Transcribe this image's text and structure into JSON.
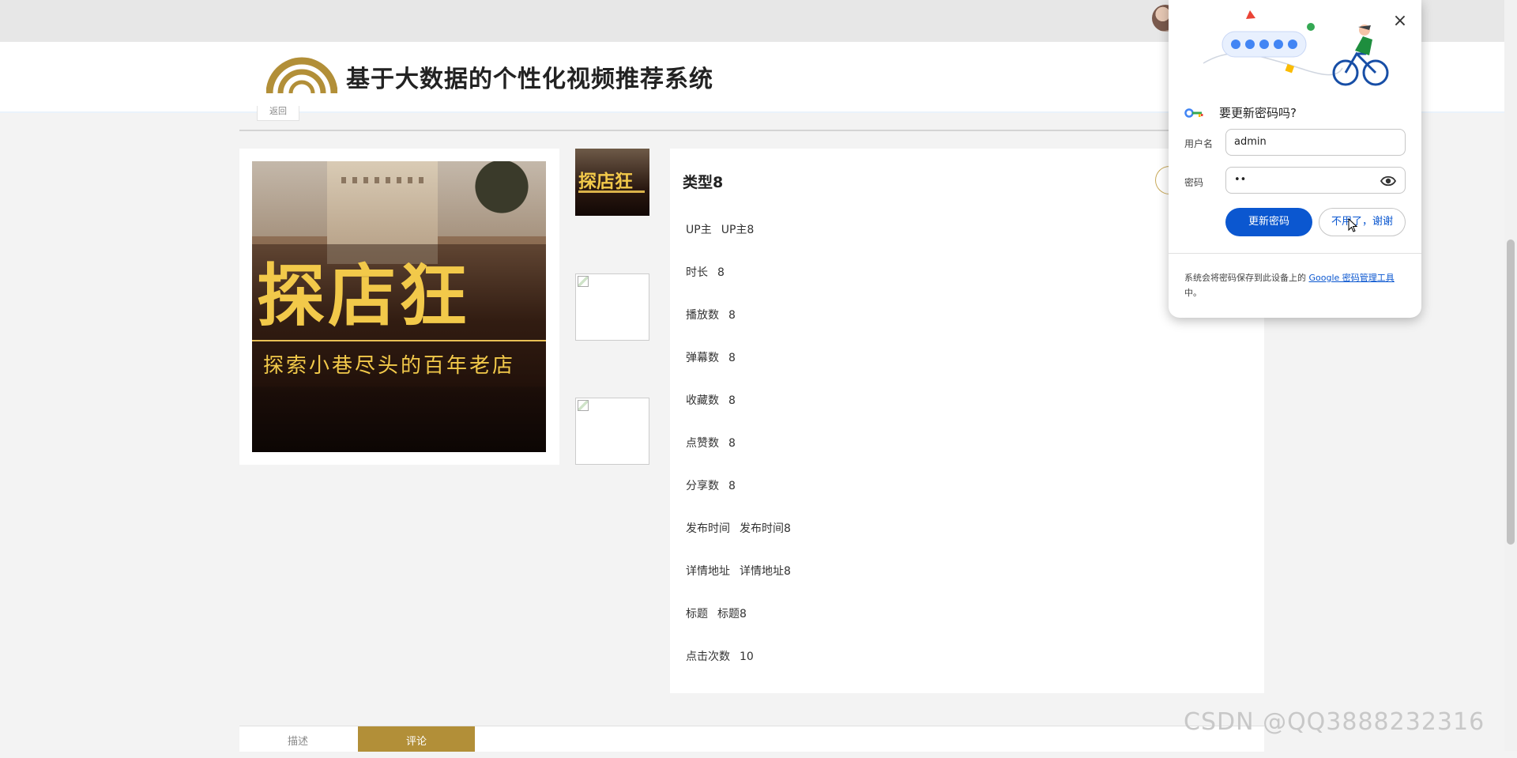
{
  "site": {
    "title": "基于大数据的个性化视频推荐系统",
    "back_label": "返回"
  },
  "poster": {
    "title": "探店狂",
    "subtitle": "探索小巷尽头的百年老店"
  },
  "thumbnails": [
    {
      "title": "探店狂"
    },
    {
      "title": ""
    },
    {
      "title": ""
    }
  ],
  "detail": {
    "title": "类型8",
    "rows": [
      {
        "key": "UP主",
        "value": "UP主8"
      },
      {
        "key": "时长",
        "value": "8"
      },
      {
        "key": "播放数",
        "value": "8"
      },
      {
        "key": "弹幕数",
        "value": "8"
      },
      {
        "key": "收藏数",
        "value": "8"
      },
      {
        "key": "点赞数",
        "value": "8"
      },
      {
        "key": "分享数",
        "value": "8"
      },
      {
        "key": "发布时间",
        "value": "发布时间8"
      },
      {
        "key": "详情地址",
        "value": "详情地址8"
      },
      {
        "key": "标题",
        "value": "标题8"
      },
      {
        "key": "点击次数",
        "value": "10"
      }
    ]
  },
  "tabs": [
    {
      "label": "描述",
      "active": false
    },
    {
      "label": "评论",
      "active": true
    }
  ],
  "password_popup": {
    "heading": "要更新密码吗?",
    "username_label": "用户名",
    "username_value": "admin",
    "password_label": "密码",
    "password_value": "••",
    "update_button": "更新密码",
    "no_thanks_button": "不用了，谢谢",
    "footer_text": "系统会将密码保存到此设备上的",
    "footer_link": "Google 密码管理工具",
    "footer_suffix": "中。"
  },
  "watermark": "CSDN @QQ3888232316",
  "colors": {
    "accent": "#b28f38",
    "primary_blue": "#0b57d0"
  },
  "icons": [
    "close-icon",
    "key-icon",
    "eye-icon",
    "logo-icon",
    "cursor-icon"
  ]
}
